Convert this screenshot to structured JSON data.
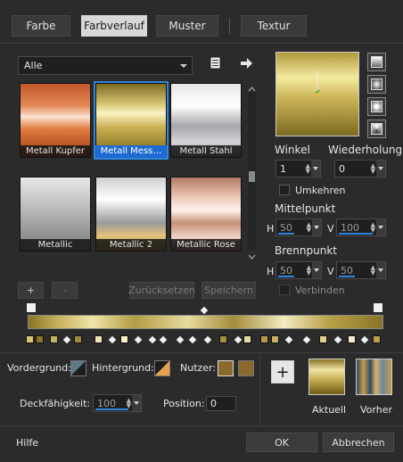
{
  "tabs": [
    "Farbe",
    "Farbverlauf",
    "Muster",
    "Textur"
  ],
  "active_tab": "Farbverlauf",
  "category": {
    "selected": "Alle"
  },
  "gradients": [
    {
      "label": "Metall Kupfer"
    },
    {
      "label": "Metall Mess…"
    },
    {
      "label": "Metall Stahl"
    },
    {
      "label": "Metallic"
    },
    {
      "label": "Metallic 2"
    },
    {
      "label": "Metallic Rose"
    }
  ],
  "selected_gradient": "Metall Mess…",
  "list_buttons": {
    "add": "+",
    "remove": "-",
    "reset": "Zurücksetzen",
    "save": "Speichern"
  },
  "settings": {
    "angle_label": "Winkel",
    "angle_value": "1",
    "repeat_label": "Wiederholung",
    "repeat_value": "0",
    "invert_label": "Umkehren",
    "midpoint_label": "Mittelpunkt",
    "focal_label": "Brennpunkt",
    "h_label": "H",
    "v_label": "V",
    "mid_h": "50",
    "mid_v": "100",
    "focal_h": "50",
    "focal_v": "50",
    "link_label": "Verbinden"
  },
  "bottom": {
    "foreground_label": "Vordergrund:",
    "background_label": "Hintergrund:",
    "user_label": "Nutzer:",
    "opacity_label": "Deckfähigkeit:",
    "opacity_value": "100",
    "position_label": "Position:",
    "position_value": "0",
    "add_label": "+",
    "current_label": "Aktuell",
    "previous_label": "Vorher"
  },
  "footer": {
    "help": "Hilfe",
    "ok": "OK",
    "cancel": "Abbrechen"
  },
  "colors": {
    "accent": "#2e86de",
    "user_color_1": "#8a6a2c",
    "user_color_2": "#8a6a2c"
  }
}
